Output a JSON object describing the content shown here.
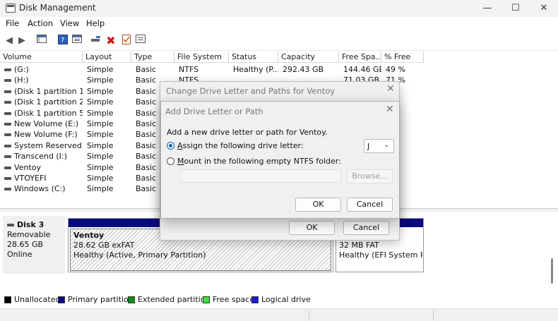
{
  "window": {
    "title": "Disk Management",
    "minimize": "—",
    "maximize": "☐",
    "close": "✕"
  },
  "menu": [
    "File",
    "Action",
    "View",
    "Help"
  ],
  "toolbar_icons": [
    "back-arrow-icon",
    "forward-arrow-icon",
    "console-tree-icon",
    "help-icon",
    "properties-icon",
    "connect-icon",
    "delete-icon",
    "checklist-icon",
    "window-icon"
  ],
  "table": {
    "columns": [
      "Volume",
      "Layout",
      "Type",
      "File System",
      "Status",
      "Capacity",
      "Free Spa...",
      "% Free"
    ],
    "rows": [
      [
        "(G:)",
        "Simple",
        "Basic",
        "NTFS",
        "Healthy (P...",
        "292.43 GB",
        "144.46 GB",
        "49 %"
      ],
      [
        "(H:)",
        "Simple",
        "Basic",
        "NTFS",
        "",
        "",
        "71.03 GB",
        "71 %"
      ],
      [
        "(Disk 1 partition 1)",
        "Simple",
        "Basic",
        "",
        "",
        "",
        "",
        "%"
      ],
      [
        "(Disk 1 partition 2)",
        "Simple",
        "Basic",
        "",
        "",
        "",
        "",
        "%"
      ],
      [
        "(Disk 1 partition 5)",
        "Simple",
        "Basic",
        "",
        "",
        "",
        "",
        "%"
      ],
      [
        "New Volume (E:)",
        "Simple",
        "Basic",
        "",
        "",
        "",
        "",
        "%"
      ],
      [
        "New Volume (F:)",
        "Simple",
        "Basic",
        "",
        "",
        "",
        "",
        "%"
      ],
      [
        "System Reserved (...",
        "Simple",
        "Basic",
        "",
        "",
        "",
        "",
        "%"
      ],
      [
        "Transcend (I:)",
        "Simple",
        "Basic",
        "",
        "",
        "",
        "",
        "%"
      ],
      [
        "Ventoy",
        "Simple",
        "Basic",
        "",
        "",
        "",
        "",
        "%"
      ],
      [
        "VTOYEFI",
        "Simple",
        "Basic",
        "",
        "",
        "",
        "",
        "%"
      ],
      [
        "Windows (C:)",
        "Simple",
        "Basic",
        "",
        "",
        "",
        "",
        "%"
      ]
    ]
  },
  "disk": {
    "name": "Disk 3",
    "kind": "Removable",
    "size": "28.65 GB",
    "status": "Online",
    "partitions": [
      {
        "name": "Ventoy",
        "size_fs": "28.62 GB exFAT",
        "health": "Healthy (Active, Primary Partition)"
      },
      {
        "name": "",
        "size_fs": "32 MB FAT",
        "health": "Healthy (EFI System Part"
      }
    ]
  },
  "legend": [
    {
      "label": "Unallocated",
      "color": "#000000"
    },
    {
      "label": "Primary partition",
      "color": "#0a0a80"
    },
    {
      "label": "Extended partition",
      "color": "#138a13"
    },
    {
      "label": "Free space",
      "color": "#39e339"
    },
    {
      "label": "Logical drive",
      "color": "#1b1bdc"
    }
  ],
  "dialog_change": {
    "title": "Change Drive Letter and Paths for Ventoy",
    "ok": "OK",
    "cancel": "Cancel"
  },
  "dialog_add": {
    "title": "Add Drive Letter or Path",
    "intro": "Add a new drive letter or path for Ventoy.",
    "assign_label_key": "A",
    "assign_label_rest": "ssign the following drive letter:",
    "selected_letter": "J",
    "mount_label_key": "M",
    "mount_label_rest": "ount in the following empty NTFS folder:",
    "browse": "Browse...",
    "ok": "OK",
    "cancel": "Cancel"
  }
}
